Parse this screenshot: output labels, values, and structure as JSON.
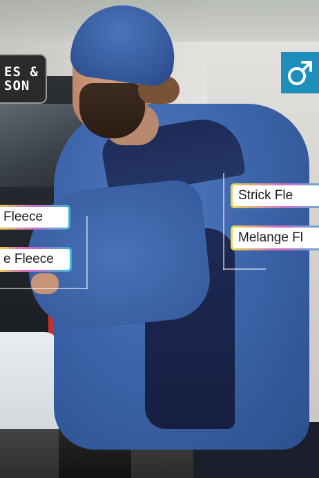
{
  "brand_badge": {
    "line1": "ES &",
    "line2": "SON"
  },
  "gender_badge": {
    "icon": "male-symbol-icon",
    "color": "#1e8fbd"
  },
  "labels": {
    "left_top": "Fleece",
    "left_bottom": "e Fleece",
    "right_top": "Strick Fle",
    "right_bottom": "Melange Fl"
  }
}
